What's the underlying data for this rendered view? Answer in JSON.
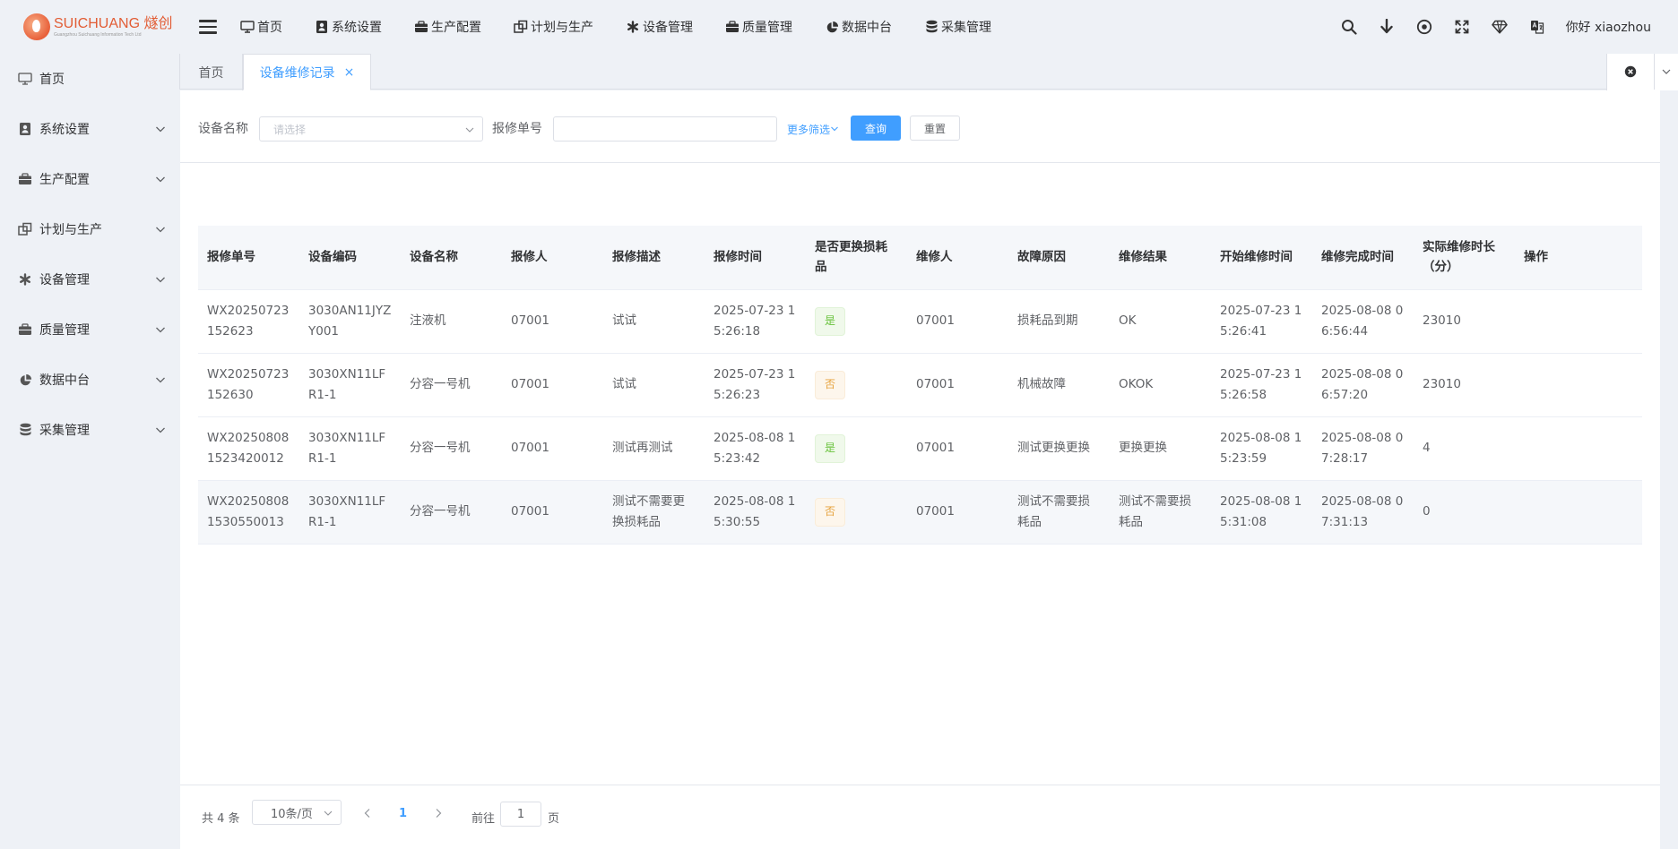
{
  "brand": {
    "name": "SUICHUANG 燧创",
    "sub": "Guangzhou Suichuang Information Tech Ltd"
  },
  "topnav": [
    {
      "label": "首页",
      "icon": "monitor-icon"
    },
    {
      "label": "系统设置",
      "icon": "user-badge-icon"
    },
    {
      "label": "生产配置",
      "icon": "briefcase-icon"
    },
    {
      "label": "计划与生产",
      "icon": "windows-icon"
    },
    {
      "label": "设备管理",
      "icon": "asterisk-icon"
    },
    {
      "label": "质量管理",
      "icon": "briefcase-icon"
    },
    {
      "label": "数据中台",
      "icon": "pie-chart-icon"
    },
    {
      "label": "采集管理",
      "icon": "database-icon"
    }
  ],
  "user": {
    "greeting": "你好 xiaozhou"
  },
  "sidebar": {
    "items": [
      {
        "label": "首页",
        "icon": "monitor-icon"
      },
      {
        "label": "系统设置",
        "icon": "user-badge-icon"
      },
      {
        "label": "生产配置",
        "icon": "briefcase-icon"
      },
      {
        "label": "计划与生产",
        "icon": "windows-icon"
      },
      {
        "label": "设备管理",
        "icon": "asterisk-icon"
      },
      {
        "label": "质量管理",
        "icon": "briefcase-icon"
      },
      {
        "label": "数据中台",
        "icon": "pie-chart-icon"
      },
      {
        "label": "采集管理",
        "icon": "database-icon"
      }
    ]
  },
  "tabs": [
    {
      "label": "首页"
    },
    {
      "label": "设备维修记录",
      "close": "×"
    }
  ],
  "filter": {
    "device_name_label": "设备名称",
    "device_name_placeholder": "请选择",
    "repair_no_label": "报修单号",
    "repair_no_value": "",
    "more_label": "更多筛选",
    "search_label": "查询",
    "reset_label": "重置"
  },
  "table": {
    "headers": [
      "报修单号",
      "设备编码",
      "设备名称",
      "报修人",
      "报修描述",
      "报修时间",
      "是否更换损耗品",
      "维修人",
      "故障原因",
      "维修结果",
      "开始维修时间",
      "维修完成时间",
      "实际维修时长（分）",
      "操作"
    ],
    "rows": [
      {
        "no": "WX20250723152623",
        "code": "3030AN11JYZY001",
        "name": "注液机",
        "reporter": "07001",
        "desc": "试试",
        "time": "2025-07-23 15:26:18",
        "replace": "是",
        "repairer": "07001",
        "cause": "损耗品到期",
        "result": "OK",
        "start": "2025-07-23 15:26:41",
        "end": "2025-08-08 06:56:44",
        "duration": "23010",
        "op": ""
      },
      {
        "no": "WX20250723152630",
        "code": "3030XN11LFR1-1",
        "name": "分容一号机",
        "reporter": "07001",
        "desc": "试试",
        "time": "2025-07-23 15:26:23",
        "replace": "否",
        "repairer": "07001",
        "cause": "机械故障",
        "result": "OKOK",
        "start": "2025-07-23 15:26:58",
        "end": "2025-08-08 06:57:20",
        "duration": "23010",
        "op": ""
      },
      {
        "no": "WX202508081523420012",
        "code": "3030XN11LFR1-1",
        "name": "分容一号机",
        "reporter": "07001",
        "desc": "测试再测试",
        "time": "2025-08-08 15:23:42",
        "replace": "是",
        "repairer": "07001",
        "cause": "测试更换更换",
        "result": "更换更换",
        "start": "2025-08-08 15:23:59",
        "end": "2025-08-08 07:28:17",
        "duration": "4",
        "op": ""
      },
      {
        "no": "WX202508081530550013",
        "code": "3030XN11LFR1-1",
        "name": "分容一号机",
        "reporter": "07001",
        "desc": "测试不需要更换损耗品",
        "time": "2025-08-08 15:30:55",
        "replace": "否",
        "repairer": "07001",
        "cause": "测试不需要损耗品",
        "result": "测试不需要损耗品",
        "start": "2025-08-08 15:31:08",
        "end": "2025-08-08 07:31:13",
        "duration": "0",
        "op": ""
      }
    ]
  },
  "pagination": {
    "total_label": "共 4 条",
    "page_size": "10条/页",
    "current_page": "1",
    "goto_label": "前往",
    "goto_value": "1",
    "page_suffix": "页"
  },
  "colors": {
    "primary": "#409eff",
    "tag_yes": "#67c23a",
    "tag_no": "#e6a23c",
    "brand": "#e25d35"
  }
}
